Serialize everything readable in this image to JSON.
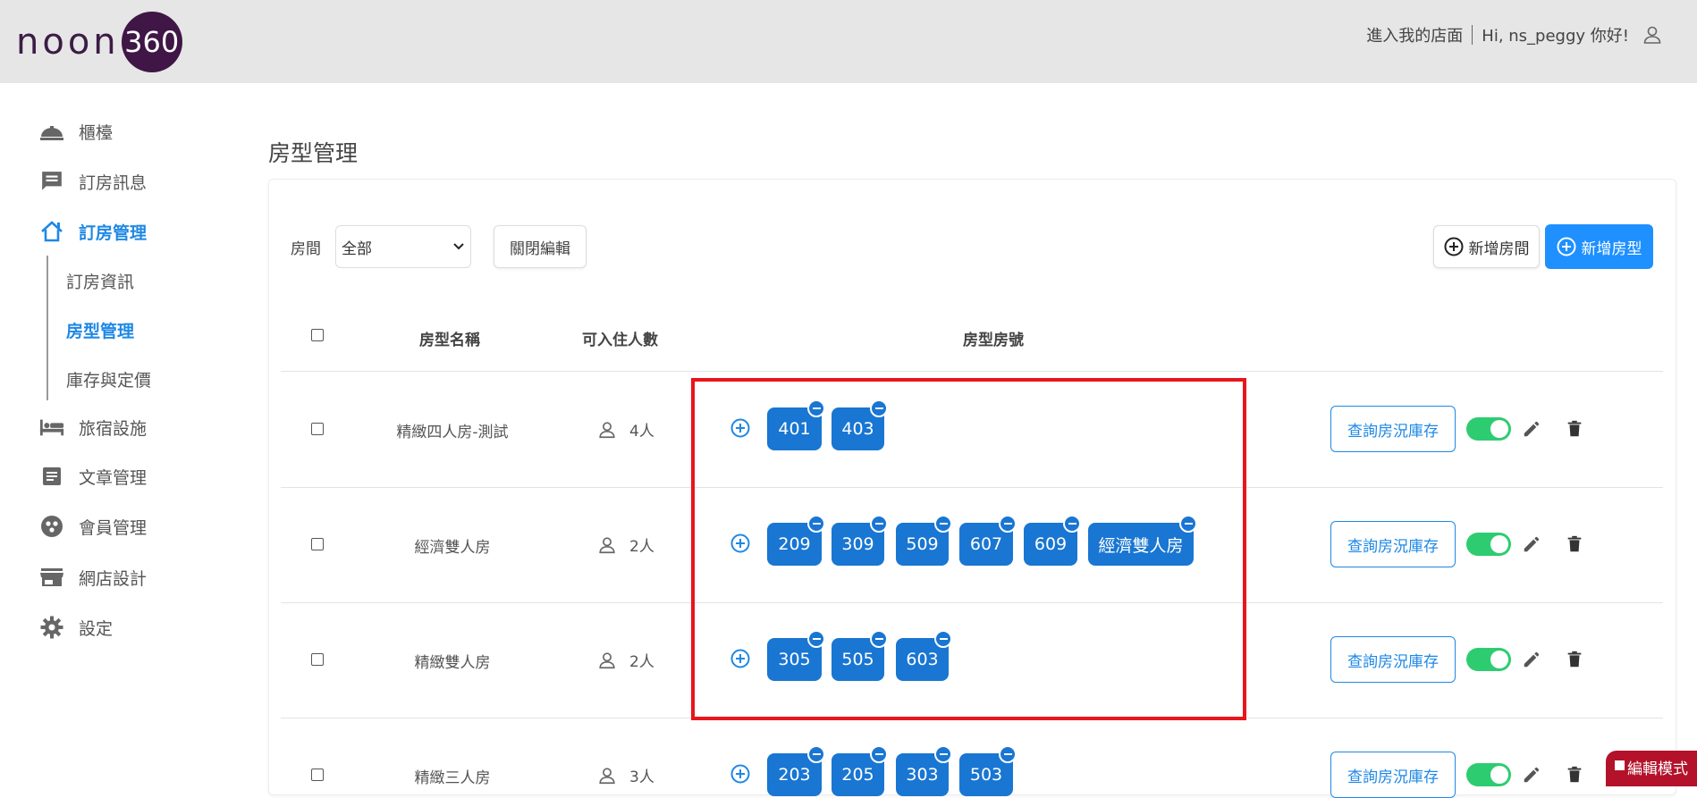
{
  "header": {
    "logo_text": "noon",
    "logo_badge": "360",
    "store_link": "進入我的店面",
    "greeting": "Hi, ns_peggy 你好!",
    "user_icon": "user-icon"
  },
  "sidebar": {
    "items": [
      {
        "label": "櫃檯",
        "icon": "bell-icon"
      },
      {
        "label": "訂房訊息",
        "icon": "message-icon"
      },
      {
        "label": "訂房管理",
        "icon": "home-icon"
      },
      {
        "label": "旅宿設施",
        "icon": "bed-icon"
      },
      {
        "label": "文章管理",
        "icon": "article-icon"
      },
      {
        "label": "會員管理",
        "icon": "members-icon"
      },
      {
        "label": "網店設計",
        "icon": "store-icon"
      },
      {
        "label": "設定",
        "icon": "gear-icon"
      }
    ],
    "sub_items": [
      {
        "label": "訂房資訊"
      },
      {
        "label": "房型管理"
      },
      {
        "label": "庫存與定價"
      }
    ]
  },
  "page": {
    "title": "房型管理",
    "filter_label": "房間",
    "filter_value": "全部",
    "close_edit_label": "關閉編輯",
    "add_room_label": "新增房間",
    "add_type_label": "新增房型"
  },
  "table": {
    "headers": {
      "name": "房型名稱",
      "capacity": "可入住人數",
      "rooms": "房型房號"
    },
    "rows": [
      {
        "name": "精緻四人房-測試",
        "capacity": "4人",
        "rooms": [
          "401",
          "403"
        ],
        "inventory_label": "查詢房況庫存",
        "enabled": true
      },
      {
        "name": "經濟雙人房",
        "capacity": "2人",
        "rooms": [
          "209",
          "309",
          "509",
          "607",
          "609",
          "經濟雙人房"
        ],
        "inventory_label": "查詢房況庫存",
        "enabled": true
      },
      {
        "name": "精緻雙人房",
        "capacity": "2人",
        "rooms": [
          "305",
          "505",
          "603"
        ],
        "inventory_label": "查詢房況庫存",
        "enabled": true
      },
      {
        "name": "精緻三人房",
        "capacity": "3人",
        "rooms": [
          "203",
          "205",
          "303",
          "503"
        ],
        "inventory_label": "查詢房況庫存",
        "enabled": true
      }
    ]
  },
  "edit_mode_label": "編輯模式",
  "colors": {
    "primary": "#1e88e5",
    "chip": "#1976d2",
    "toggle_on": "#2ecc71",
    "highlight": "#e8151b",
    "edit_mode_bg": "#b3122a",
    "logo": "#3f1646"
  }
}
